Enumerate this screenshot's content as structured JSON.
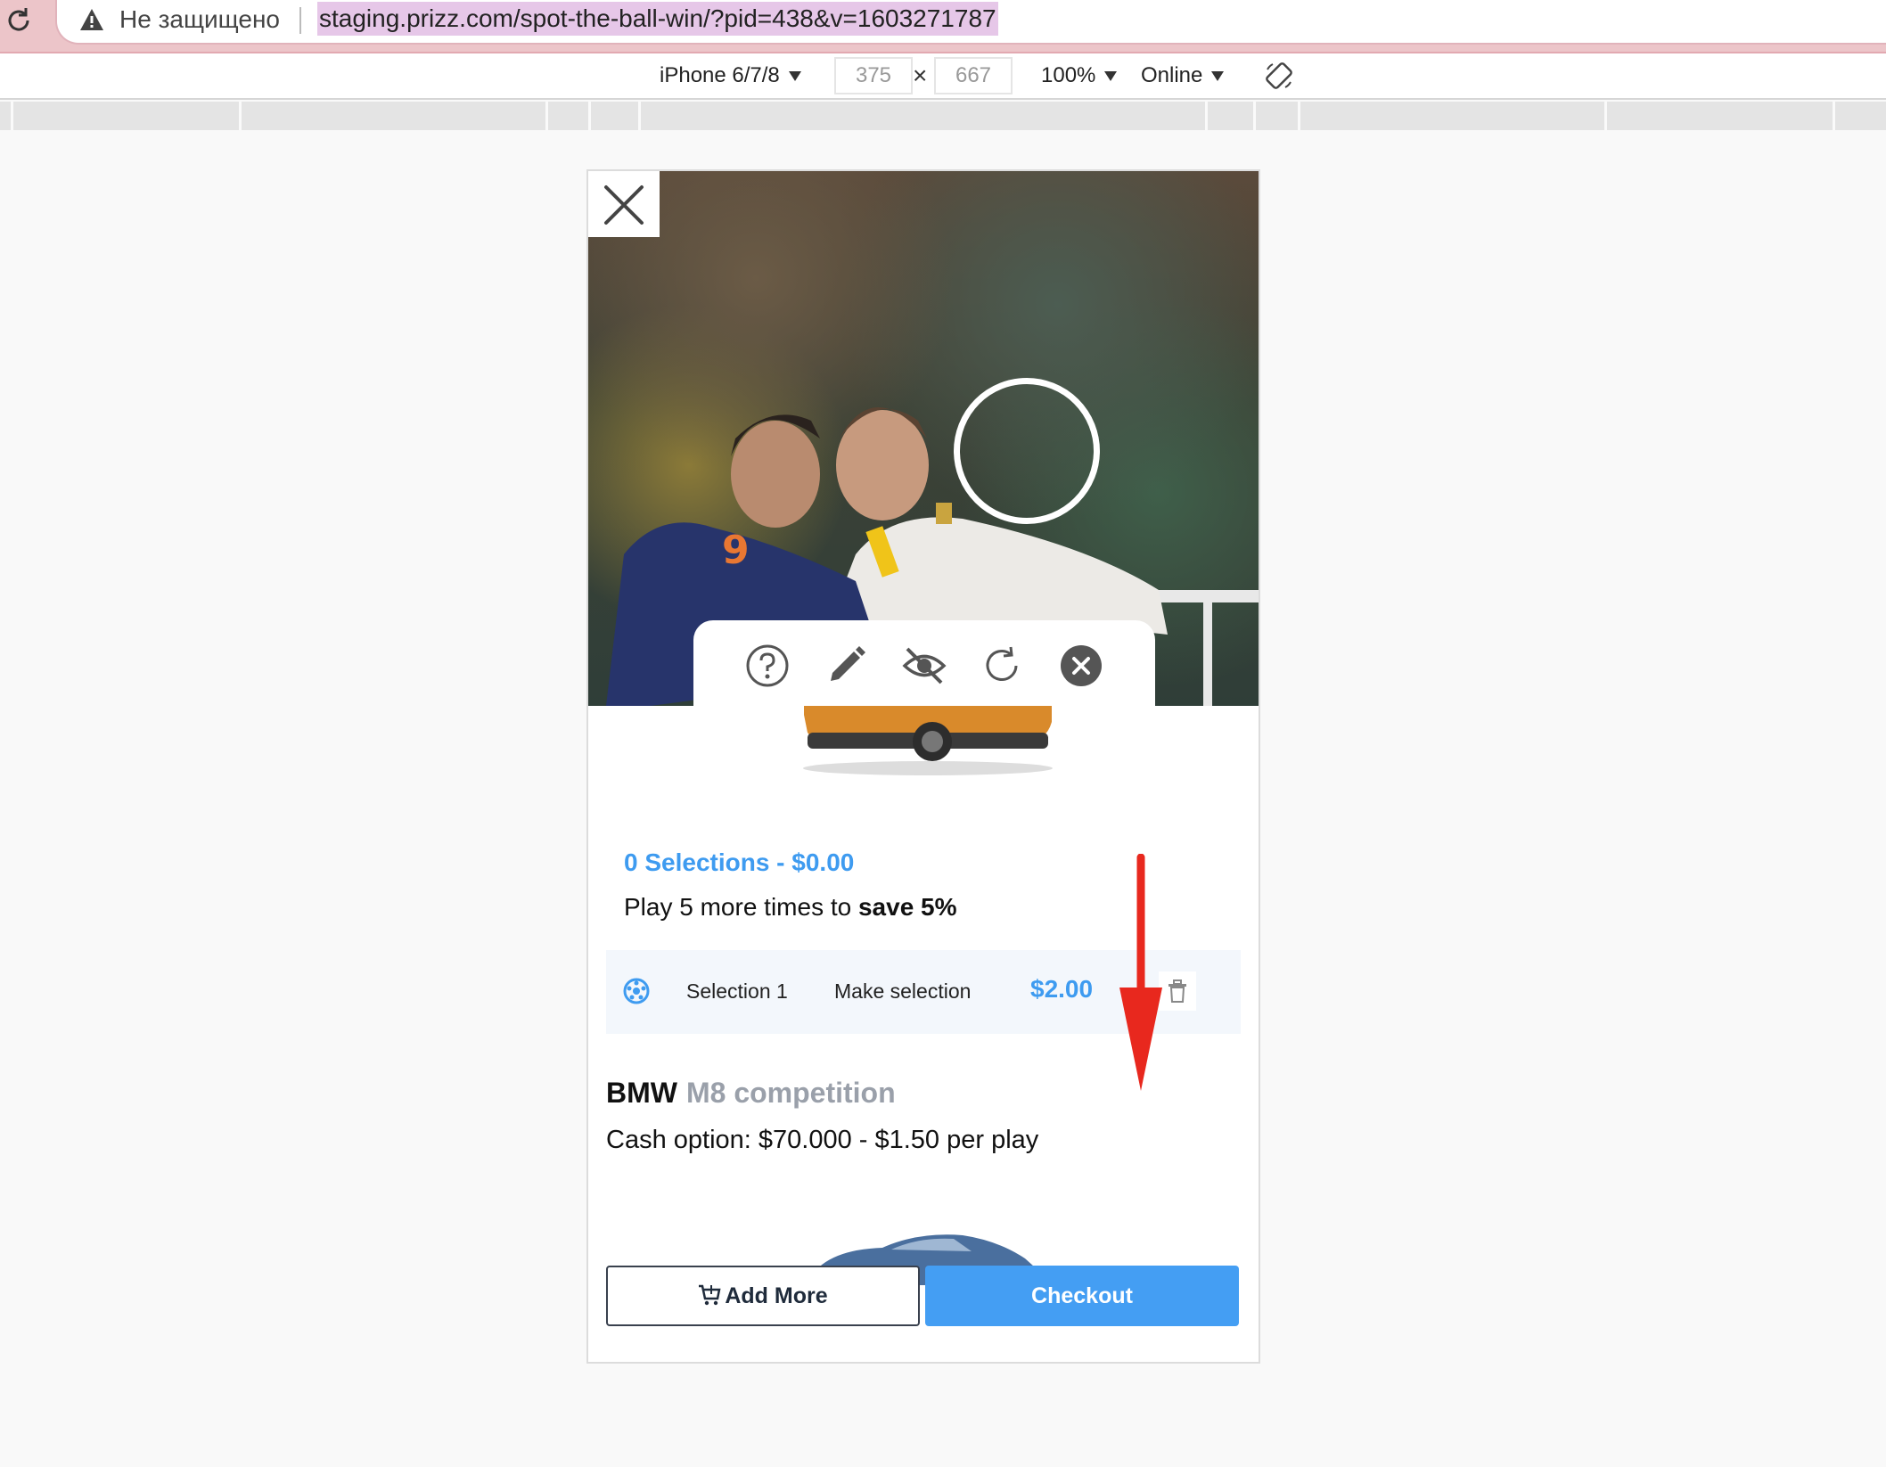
{
  "browser": {
    "not_secure_label": "Не защищено",
    "url": "staging.prizz.com/spot-the-ball-win/?pid=438&v=1603271787"
  },
  "device_toolbar": {
    "device": "iPhone 6/7/8",
    "width": "375",
    "height": "667",
    "zoom": "100%",
    "network": "Online"
  },
  "game": {
    "summary_title": "0 Selections - $0.00",
    "summary_prefix": "Play 5 more times to ",
    "summary_bold": "save 5%",
    "selection": {
      "name": "Selection 1",
      "action": "Make selection",
      "price": "$2.00"
    },
    "prize": {
      "make": "BMW",
      "model": "M8 competition",
      "cash_option": "Cash option: $70.000 - $1.50 per play"
    },
    "buttons": {
      "add_more": "Add More",
      "checkout": "Checkout"
    },
    "tool_icons": [
      "help-icon",
      "pencil-icon",
      "eye-off-icon",
      "refresh-icon",
      "close-circle-icon"
    ]
  },
  "colors": {
    "accent": "#3e9bf0",
    "checkout": "#449ef3",
    "annotation": "#e8281e"
  }
}
